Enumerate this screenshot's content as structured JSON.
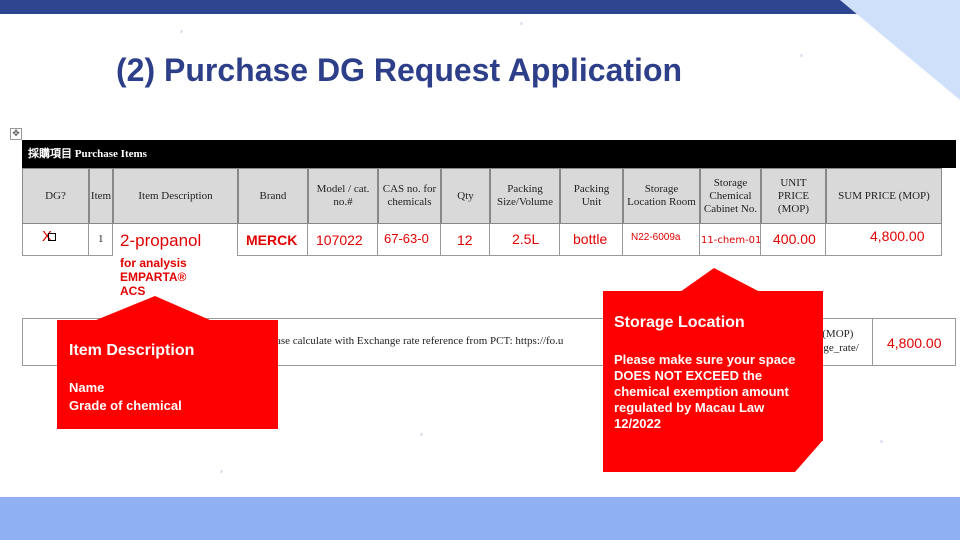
{
  "slide": {
    "title": "(2) Purchase DG Request Application"
  },
  "table": {
    "section_header": "採購項目 Purchase Items",
    "columns": [
      {
        "label": "DG?",
        "width": 67
      },
      {
        "label": "Item",
        "width": 24
      },
      {
        "label": "Item Description",
        "width": 125
      },
      {
        "label": "Brand",
        "width": 70
      },
      {
        "label": "Model / cat. no.#",
        "width": 70
      },
      {
        "label": "CAS no. for chemicals",
        "width": 63
      },
      {
        "label": "Qty",
        "width": 49
      },
      {
        "label": "Packing Size/Volume",
        "width": 70
      },
      {
        "label": "Packing Unit",
        "width": 63
      },
      {
        "label": "Storage Location Room",
        "width": 77
      },
      {
        "label": "Storage Chemical Cabinet No.",
        "width": 61
      },
      {
        "label": "UNIT PRICE (MOP)",
        "width": 65
      },
      {
        "label": "SUM PRICE (MOP)",
        "width": 116
      }
    ],
    "row": {
      "dg": "X",
      "item_no": "1",
      "description_name": "2-propanol",
      "description_grade_lines": [
        "for analysis",
        "EMPARTA®",
        "ACS"
      ],
      "brand": "MERCK",
      "model": "107022",
      "cas": "67-63-0",
      "qty": "12",
      "packing_size": "2.5L",
      "packing_unit": "bottle",
      "storage_room": "N22-6009a",
      "storage_cabinet": "11-chem-01",
      "unit_price": "400.00",
      "sum_price": "4,800.00"
    },
    "footer": {
      "note": "lease calculate with Exchange rate reference from PCT: https://fo.u",
      "mop_label_lines": [
        "T (MOP)",
        "ange_rate/"
      ],
      "total": "4,800.00"
    }
  },
  "callouts": {
    "item_description": {
      "title": "Item Description",
      "lines": [
        "Name",
        "Grade of chemical"
      ]
    },
    "storage_location": {
      "title": "Storage Location",
      "body": "Please make sure your space DOES NOT EXCEED the chemical exemption amount regulated by Macau Law 12/2022"
    }
  },
  "theme": {
    "title_color": "#2e3f8a",
    "callout_color": "#ff0000",
    "top_bar_color": "#2e4590",
    "bottom_band_color": "#8fb0f3"
  }
}
